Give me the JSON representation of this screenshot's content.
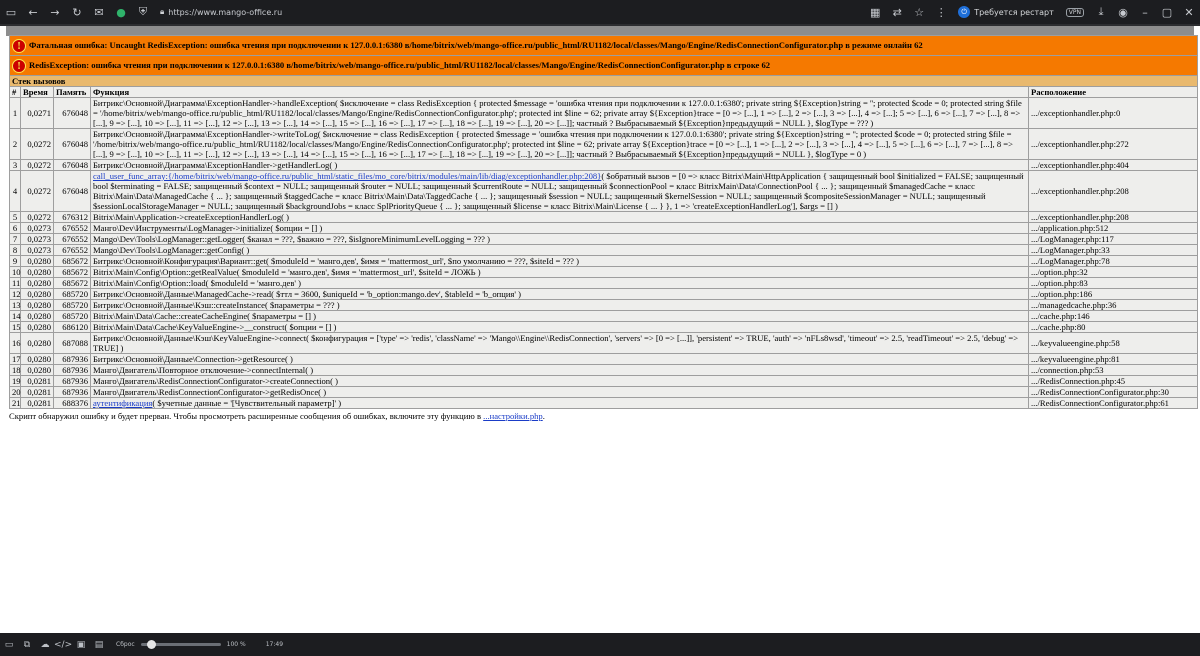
{
  "browser": {
    "url": "https://www.mango-office.ru",
    "update_label": "Требуется рестарт",
    "vpn_label": "VPN"
  },
  "error": {
    "fatal_title": "Фатальная ошибка: Uncaught RedisException: ошибка чтения при подключении к 127.0.0.1:6380 в/home/bitrix/web/mango-office.ru/public_html/RU1182/local/classes/Mango/Engine/RedisConnectionConfigurator.php в режиме онлайн 62",
    "exception_title": "RedisException: ошибка чтения при подключении к 127.0.0.1:6380 в/home/bitrix/web/mango-office.ru/public_html/RU1182/local/classes/Mango/Engine/RedisConnectionConfigurator.php в строке 62",
    "stack_label": "Стек вызовов",
    "columns": {
      "num": "#",
      "time": "Время",
      "memory": "Память",
      "function": "Функция",
      "location": "Расположение"
    },
    "rows": [
      {
        "num": "1",
        "time": "0,0271",
        "memory": "676048",
        "function": "Битрикс\\Основной\\Диаграмма\\ExceptionHandler->handleException( $исключение = class RedisException { protected $message = 'ошибка чтения при подключении к 127.0.0.1:6380'; private string ${Exception}string = ''; protected $code = 0; protected string $file = '/home/bitrix/web/mango-office.ru/public_html/RU1182/local/classes/Mango/Engine/RedisConnectionConfigurator.php'; protected int $line = 62; private array ${Exception}trace = [0 => [...], 1 => [...], 2 => [...], 3 => [...], 4 => [...]; 5 => [...], 6 => [...], 7 => [...], 8 => [...], 9 => [...], 10 => [...], 11 => [...], 12 => [...], 13 => [...], 14 => [...], 15 => [...], 16 => [...], 17 => [...], 18 => [...], 19 => [...], 20 => [...]]; частный ? Выбрасываемый ${Exception}предыдущий = NULL }, $logType = ??? )",
        "location": ".../exceptionhandler.php:0"
      },
      {
        "num": "2",
        "time": "0,0272",
        "memory": "676048",
        "function": "Битрикс\\Основной\\Диаграмма\\ExceptionHandler->writeToLog( $исключение = class RedisException { protected $message = 'ошибка чтения при подключении к 127.0.0.1:6380'; private string ${Exception}string = ''; protected $code = 0; protected string $file = '/home/bitrix/web/mango-office.ru/public_html/RU1182/local/classes/Mango/Engine/RedisConnectionConfigurator.php'; protected int $line = 62; private array ${Exception}trace = [0 => [...], 1 => [...], 2 => [...], 3 => [...], 4 => [...], 5 => [...], 6 => [...], 7 => [...], 8 => [...], 9 => [...], 10 => [...], 11 => [...], 12 => [...], 13 => [...], 14 => [...], 15 => [...], 16 => [...], 17 => [...], 18 => [...], 19 => [...], 20 => [...]]; частный ? Выбрасываемый ${Exception}предыдущий = NULL }, $logType = 0 )",
        "location": ".../exceptionhandler.php:272"
      },
      {
        "num": "3",
        "time": "0,0272",
        "memory": "676048",
        "function": "Битрикс\\Основной\\Диаграмма\\ExceptionHandler->getHandlerLog( )",
        "location": ".../exceptionhandler.php:404"
      },
      {
        "num": "4",
        "time": "0,0272",
        "memory": "676048",
        "link": "call_user_func_array:{/home/bitrix/web/mango-office.ru/public_html/static_files/mo_core/bitrix/modules/main/lib/diag/exceptionhandler.php:208}",
        "function": "( $обратный вызов = [0 => класс Bitrix\\Main\\HttpApplication { защищенный bool $initialized = FALSE; защищенный bool $terminating = FALSE; защищенный $context = NULL; защищенный $router = NULL; защищенный $currentRoute = NULL; защищенный $connectionPool = класс BitrixMain\\Data\\ConnectionPool { ... }; защищенный $managedCache = класс Bitrix\\Main\\Data\\ManagedCache { ... }; защищенный $taggedCache = класс Bitrix\\Main\\Data\\TaggedCache { ... }; защищенный $session = NULL; защищенный $kernelSession = NULL; защищенный $compositeSessionManager = NULL; защищенный $sessionLocalStorageManager = NULL; защищенный $backgroundJobs = класс SplPriorityQueue { ... }; защищенный $license = класс Bitrix\\Main\\License { ... } }, 1 => 'createExceptionHandlerLog'], $args = [] )",
        "location": ".../exceptionhandler.php:208"
      },
      {
        "num": "5",
        "time": "0,0272",
        "memory": "676312",
        "function": "Bitrix\\Main\\Application->createExceptionHandlerLog( )",
        "location": ".../exceptionhandler.php:208"
      },
      {
        "num": "6",
        "time": "0,0273",
        "memory": "676552",
        "function": "Манго\\Dev\\Инструменты\\LogManager->initialize( $опции = [] )",
        "location": ".../application.php:512"
      },
      {
        "num": "7",
        "time": "0,0273",
        "memory": "676552",
        "function": "Mango\\Dev\\Tools\\LogManager::getLogger( $канал = ???, $важно = ???, $isIgnoreMinimumLevelLogging = ??? )",
        "location": ".../LogManager.php:117"
      },
      {
        "num": "8",
        "time": "0,0273",
        "memory": "676552",
        "function": "Mango\\Dev\\Tools\\LogManager::getConfig( )",
        "location": ".../LogManager.php:33"
      },
      {
        "num": "9",
        "time": "0,0280",
        "memory": "685672",
        "function": "Битрикс\\Основной\\Конфигурация\\Вариант::get( $moduleId = 'манго.дев', $имя = 'mattermost_url', $по умолчанию = ???, $siteId = ??? )",
        "location": ".../LogManager.php:78"
      },
      {
        "num": "10",
        "time": "0,0280",
        "memory": "685672",
        "function": "Bitrix\\Main\\Config\\Option::getRealValue( $moduleId = 'манго.дев', $имя = 'mattermost_url', $siteId = ЛОЖЬ )",
        "location": ".../option.php:32"
      },
      {
        "num": "11",
        "time": "0,0280",
        "memory": "685672",
        "function": "Bitrix\\Main\\Config\\Option::load( $moduleId = 'манго.дев' )",
        "location": ".../option.php:83"
      },
      {
        "num": "12",
        "time": "0,0280",
        "memory": "685720",
        "function": "Битрикс\\Основной\\Данные\\ManagedCache->read( $ттл = 3600, $uniqueId = 'b_option:mango.dev', $tableId = 'b_опция' )",
        "location": ".../option.php:186"
      },
      {
        "num": "13",
        "time": "0,0280",
        "memory": "685720",
        "function": "Битрикс\\Основной\\Данные\\Кэш::createInstance( $параметры = ??? )",
        "location": ".../managedcache.php:36"
      },
      {
        "num": "14",
        "time": "0,0280",
        "memory": "685720",
        "function": "Bitrix\\Main\\Data\\Cache::createCacheEngine( $параметры = [] )",
        "location": ".../cache.php:146"
      },
      {
        "num": "15",
        "time": "0,0280",
        "memory": "686120",
        "function": "Bitrix\\Main\\Data\\Cache\\KeyValueEngine->__construct( $опции = [] )",
        "location": ".../cache.php:80"
      },
      {
        "num": "16",
        "time": "0,0280",
        "memory": "687088",
        "function": "Битрикс\\Основной\\Данные\\Кэш\\KeyValueEngine->connect( $конфигурация = ['type' => 'redis', 'className' => 'Mango\\\\Engine\\\\RedisConnection', 'servers' => [0 => [...]], 'persistent' => TRUE, 'auth' => 'nFLs8wsd', 'timeout' => 2.5, 'readTimeout' => 2.5, 'debug' => TRUE] )",
        "location": ".../keyvalueengine.php:58"
      },
      {
        "num": "17",
        "time": "0,0280",
        "memory": "687936",
        "function": "Битрикс\\Основной\\Данные\\Connection->getResource( )",
        "location": ".../keyvalueengine.php:81"
      },
      {
        "num": "18",
        "time": "0,0280",
        "memory": "687936",
        "function": "Манго\\Двигатель\\Повторное отключение->connectInternal( )",
        "location": ".../connection.php:53"
      },
      {
        "num": "19",
        "time": "0,0281",
        "memory": "687936",
        "function": "Манго\\Двигатель\\RedisConnectionConfigurator->createConnection( )",
        "location": ".../RedisConnection.php:45"
      },
      {
        "num": "20",
        "time": "0,0281",
        "memory": "687936",
        "function": "Манго\\Двигатель\\RedisConnectionConfigurator->getRedisOnce( )",
        "location": ".../RedisConnectionConfigurator.php:30"
      },
      {
        "num": "21",
        "time": "0,0281",
        "memory": "688376",
        "link": "аутентификация",
        "function": "( $учетные данные = '[Чувствительный параметр]' )",
        "location": ".../RedisConnectionConfigurator.php:61"
      }
    ],
    "note": "Скрипт обнаружил ошибку и будет прерван. Чтобы просмотреть расширенные сообщения об ошибках, включите эту функцию в",
    "note_link": "...настройки.php",
    "note_end": "."
  },
  "statusbar": {
    "reset_label": "Сброс",
    "zoom": "100 %",
    "time": "17:49"
  }
}
